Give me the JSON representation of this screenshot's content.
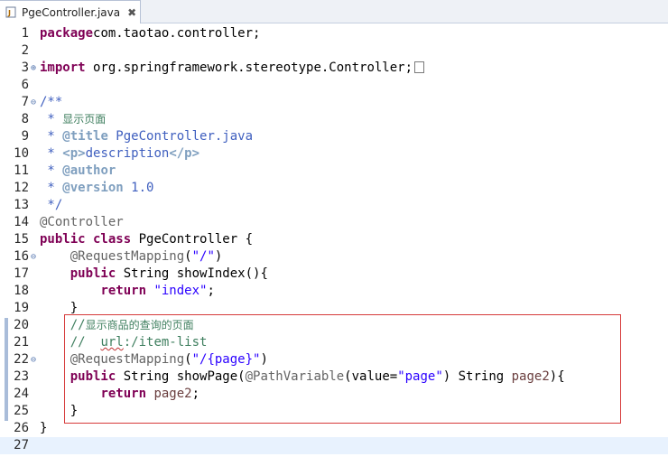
{
  "tab": {
    "title": "PgeController.java",
    "close_glyph": "✖"
  },
  "lines": [
    {
      "n": "1",
      "fold": "",
      "t": [
        [
          "kw",
          "package"
        ],
        [
          "",
          "com.taotao.controller;"
        ]
      ]
    },
    {
      "n": "2",
      "fold": "",
      "t": []
    },
    {
      "n": "3",
      "fold": "⊕",
      "t": [
        [
          "kw",
          "import"
        ],
        [
          "",
          " org.springframework.stereotype.Controller;"
        ]
      ],
      "collapsed": true
    },
    {
      "n": "6",
      "fold": "",
      "t": []
    },
    {
      "n": "7",
      "fold": "⊖",
      "t": [
        [
          "jd",
          "/**"
        ]
      ]
    },
    {
      "n": "8",
      "fold": "",
      "t": [
        [
          "jd",
          " * "
        ],
        [
          "cmt cn",
          "显示页面"
        ]
      ]
    },
    {
      "n": "9",
      "fold": "",
      "t": [
        [
          "jd",
          " * "
        ],
        [
          "tag",
          "@title"
        ],
        [
          "jd",
          " PgeController.java"
        ]
      ]
    },
    {
      "n": "10",
      "fold": "",
      "t": [
        [
          "jd",
          " * "
        ],
        [
          "tag",
          "<p>"
        ],
        [
          "jd",
          "description"
        ],
        [
          "tag",
          "</p>"
        ]
      ]
    },
    {
      "n": "11",
      "fold": "",
      "t": [
        [
          "jd",
          " * "
        ],
        [
          "tag",
          "@author"
        ]
      ]
    },
    {
      "n": "12",
      "fold": "",
      "t": [
        [
          "jd",
          " * "
        ],
        [
          "tag",
          "@version"
        ],
        [
          "jd",
          " 1.0"
        ]
      ]
    },
    {
      "n": "13",
      "fold": "",
      "t": [
        [
          "jd",
          " */"
        ]
      ]
    },
    {
      "n": "14",
      "fold": "",
      "t": [
        [
          "ann",
          "@Controller"
        ]
      ]
    },
    {
      "n": "15",
      "fold": "",
      "t": [
        [
          "kw",
          "public class"
        ],
        [
          "",
          " PgeController {"
        ]
      ]
    },
    {
      "n": "16",
      "fold": "⊖",
      "t": [
        [
          "",
          "    "
        ],
        [
          "ann",
          "@RequestMapping"
        ],
        [
          "",
          "("
        ],
        [
          "str",
          "\"/\""
        ],
        [
          "",
          ")"
        ]
      ]
    },
    {
      "n": "17",
      "fold": "",
      "t": [
        [
          "",
          "    "
        ],
        [
          "kw",
          "public"
        ],
        [
          "",
          " String showIndex(){"
        ]
      ]
    },
    {
      "n": "18",
      "fold": "",
      "t": [
        [
          "",
          "        "
        ],
        [
          "kw",
          "return"
        ],
        [
          "",
          ""
        ],
        [
          "str",
          " \"index\""
        ],
        [
          "",
          ";"
        ]
      ]
    },
    {
      "n": "19",
      "fold": "",
      "t": [
        [
          "",
          "    }"
        ]
      ]
    },
    {
      "n": "20",
      "fold": "",
      "t": [
        [
          "",
          "    "
        ],
        [
          "cmt",
          "//"
        ],
        [
          "cmt cn",
          "显示商品的查询的页面"
        ]
      ]
    },
    {
      "n": "21",
      "fold": "",
      "t": [
        [
          "",
          "    "
        ],
        [
          "cmt",
          "//  "
        ],
        [
          "cmt squig",
          "url"
        ],
        [
          "cmt",
          ":/item-list"
        ]
      ]
    },
    {
      "n": "22",
      "fold": "⊖",
      "t": [
        [
          "",
          "    "
        ],
        [
          "ann",
          "@RequestMapping"
        ],
        [
          "",
          "("
        ],
        [
          "str",
          "\"/{page}\""
        ],
        [
          "",
          ")"
        ]
      ]
    },
    {
      "n": "23",
      "fold": "",
      "t": [
        [
          "",
          "    "
        ],
        [
          "kw",
          "public"
        ],
        [
          "",
          " String showPage("
        ],
        [
          "ann",
          "@PathVariable"
        ],
        [
          "",
          "(value="
        ],
        [
          "str",
          "\"page\""
        ],
        [
          "",
          ") String "
        ],
        [
          "var",
          "page2"
        ],
        [
          "",
          "){"
        ]
      ]
    },
    {
      "n": "24",
      "fold": "",
      "t": [
        [
          "",
          "        "
        ],
        [
          "kw",
          "return"
        ],
        [
          "",
          " "
        ],
        [
          "var",
          "page2"
        ],
        [
          "",
          ";"
        ]
      ]
    },
    {
      "n": "25",
      "fold": "",
      "t": [
        [
          "",
          "    }"
        ]
      ]
    },
    {
      "n": "26",
      "fold": "",
      "t": [
        [
          "",
          "}"
        ]
      ]
    },
    {
      "n": "27",
      "fold": "",
      "t": []
    }
  ]
}
